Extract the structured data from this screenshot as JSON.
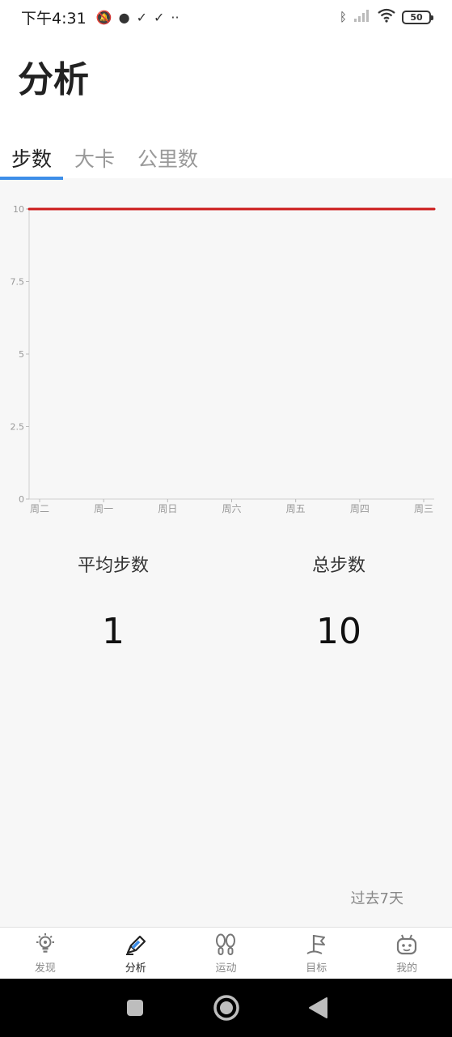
{
  "status_bar": {
    "time": "下午4:31",
    "battery": "50",
    "icons_left": [
      "mute-bell-icon",
      "chat-icon",
      "check-icon",
      "check-icon",
      "more-dots-icon"
    ],
    "icons_right": [
      "bluetooth-icon",
      "signal-icon",
      "wifi-icon",
      "battery-icon"
    ]
  },
  "header": {
    "title": "分析"
  },
  "tabs": [
    {
      "label": "步数",
      "active": true
    },
    {
      "label": "大卡",
      "active": false
    },
    {
      "label": "公里数",
      "active": false
    }
  ],
  "chart_data": {
    "type": "line",
    "categories": [
      "周二",
      "周一",
      "周日",
      "周六",
      "周五",
      "周四",
      "周三"
    ],
    "series": [
      {
        "values": [
          10,
          10,
          10,
          10,
          10,
          10,
          10
        ],
        "color": "#cc1a1a"
      }
    ],
    "ylim": [
      0,
      10
    ],
    "yticks": [
      "0",
      "2.5",
      "5",
      "7.5",
      "10"
    ],
    "grid": false
  },
  "stats": {
    "avg_label": "平均步数",
    "avg_value": "1",
    "total_label": "总步数",
    "total_value": "10"
  },
  "period_label": "过去7天",
  "bottom_nav": [
    {
      "label": "发现",
      "icon": "lightbulb-icon",
      "active": false
    },
    {
      "label": "分析",
      "icon": "pen-icon",
      "active": true
    },
    {
      "label": "运动",
      "icon": "footprints-icon",
      "active": false
    },
    {
      "label": "目标",
      "icon": "flag-icon",
      "active": false
    },
    {
      "label": "我的",
      "icon": "robot-face-icon",
      "active": false
    }
  ],
  "colors": {
    "accent": "#3d8ee8",
    "line": "#cc1a1a"
  }
}
